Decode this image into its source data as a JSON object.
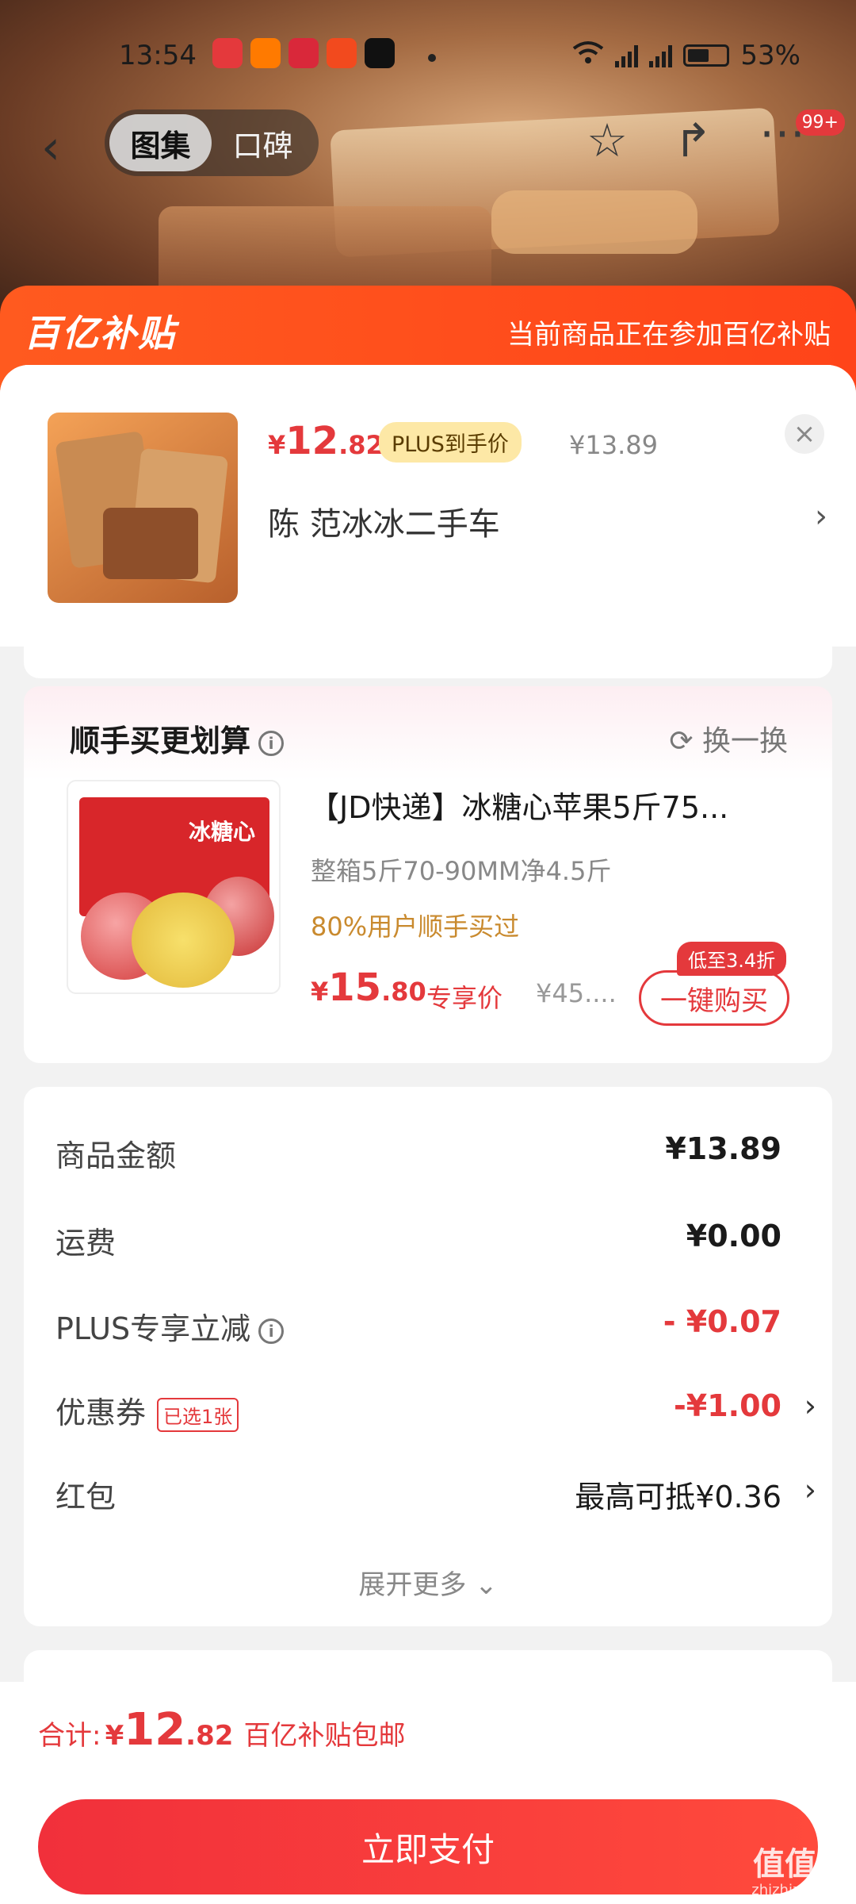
{
  "status_bar": {
    "time": "13:54",
    "battery": "53%",
    "signal_1": "5G",
    "signal_2": "5G"
  },
  "nav": {
    "tabs": [
      {
        "label": "图集",
        "active": true
      },
      {
        "label": "口碑",
        "active": false
      }
    ],
    "badge": "99+"
  },
  "banner": {
    "logo": "百亿补贴",
    "notice": "当前商品正在参加百亿补贴"
  },
  "product": {
    "price_currency": "¥",
    "price_int": "12",
    "price_dec": ".82",
    "plus_tag": "PLUS到手价",
    "original_price": "¥13.89",
    "close": "×",
    "seller": "陈  范冰冰二手车",
    "seller_arrow": "›"
  },
  "recommend": {
    "title": "顺手买更划算",
    "swap": "换一换",
    "box_text": "冰糖心",
    "name": "【JD快递】冰糖心苹果5斤75...",
    "spec": "整箱5斤70-90MM净4.5斤",
    "rate": "80%用户顺手买过",
    "price_currency": "¥",
    "price_int": "15",
    "price_dec": ".80",
    "exclusive": "专享价",
    "original": "¥45....",
    "discount_tag": "低至3.4折",
    "buy_label": "一键购买"
  },
  "summary": {
    "rows": [
      {
        "label": "商品金额",
        "value": "¥13.89"
      },
      {
        "label": "运费",
        "value": "¥0.00"
      },
      {
        "label": "PLUS专享立减",
        "value": "- ¥0.07"
      },
      {
        "label": "优惠券",
        "tag": "已选1张",
        "value": "-¥1.00"
      },
      {
        "label": "红包",
        "value": "最高可抵¥0.36"
      }
    ],
    "expand": "展开更多",
    "expand_icon": "⌄"
  },
  "footer": {
    "total_label": "合计:",
    "total_currency": "¥",
    "total_int": "12",
    "total_dec": ".82",
    "free_shipping": "百亿补贴包邮",
    "pay_label": "立即支付"
  },
  "watermark": {
    "text": "值值值",
    "site": "zhizhizhi.com"
  },
  "colors": {
    "accent": "#e4393c",
    "banner": "#ff5a1f",
    "plus_tag_bg": "#fde8a6"
  }
}
